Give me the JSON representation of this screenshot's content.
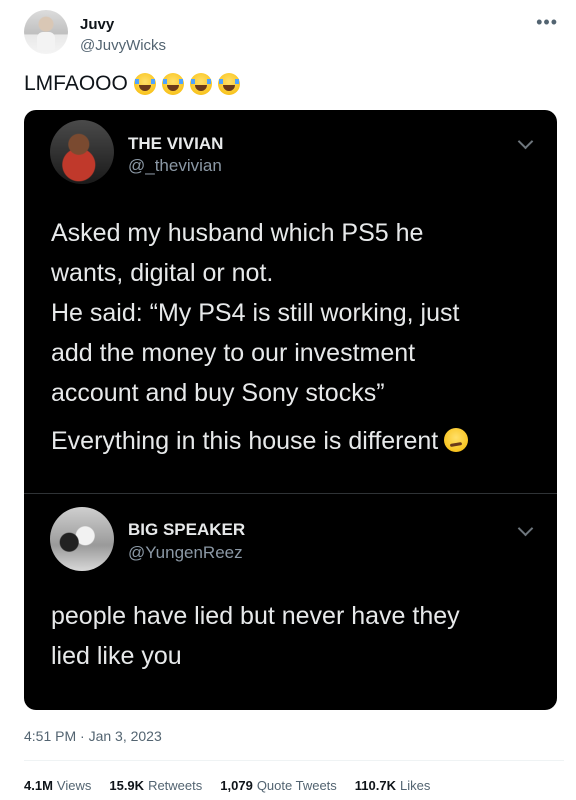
{
  "header": {
    "name": "Juvy",
    "handle": "@JuvyWicks",
    "more_icon": "more-horizontal-icon"
  },
  "tweet": {
    "text": "LMFAOOO",
    "emoji": "face-with-tears-of-joy",
    "emoji_count": 4
  },
  "quoted": [
    {
      "name": "THE VIVIAN",
      "handle": "@_thevivian",
      "lines": [
        "Asked my husband which PS5 he",
        "wants, digital or not.",
        "He said: “My PS4 is still working, just",
        "add the money to our investment",
        "account and buy Sony stocks”",
        "Everything in this house is different"
      ]
    },
    {
      "name": "BIG SPEAKER",
      "handle": "@YungenReez",
      "lines": [
        "people have lied but never have they",
        "lied like you"
      ]
    }
  ],
  "meta": {
    "timestamp": "4:51 PM · Jan 3, 2023"
  },
  "stats": {
    "views_value": "4.1M",
    "views_label": "Views",
    "retweets_value": "15.9K",
    "retweets_label": "Retweets",
    "quotes_value": "1,079",
    "quotes_label": "Quote Tweets",
    "likes_value": "110.7K",
    "likes_label": "Likes"
  },
  "colors": {
    "text": "#0f1419",
    "secondary": "#536471",
    "card_bg": "#000000",
    "card_text": "#e7e9ea"
  }
}
